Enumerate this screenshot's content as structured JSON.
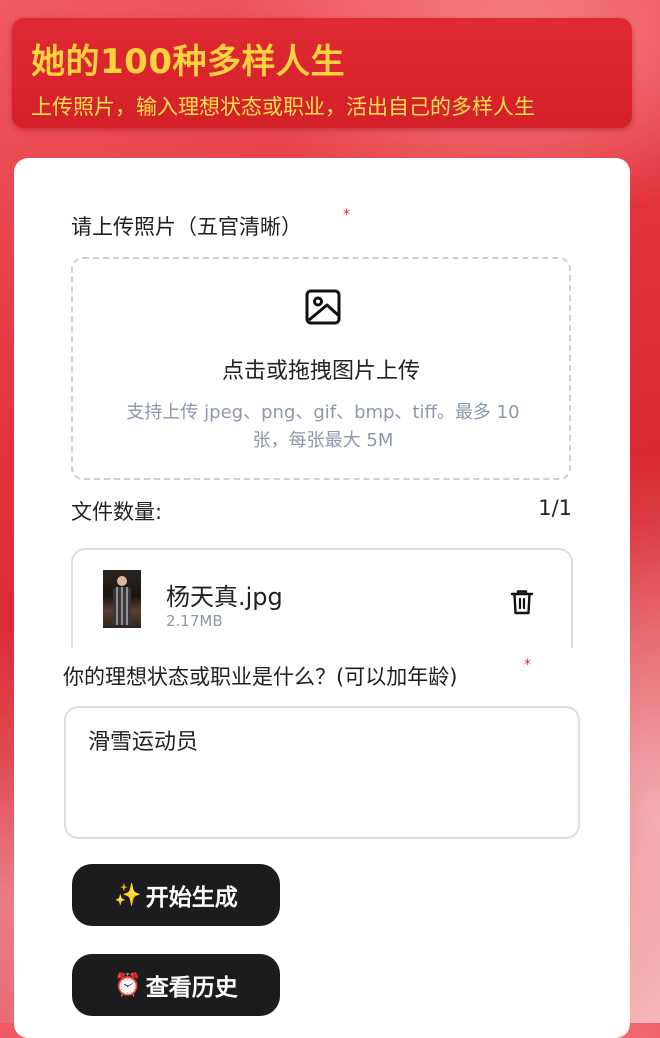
{
  "header": {
    "title": "她的100种多样人生",
    "subtitle": "上传照片，输入理想状态或职业，活出自己的多样人生"
  },
  "upload": {
    "label": "请上传照片（五官清晰）",
    "required_mark": "*",
    "dropzone_title": "点击或拖拽图片上传",
    "dropzone_hint": "支持上传 jpeg、png、gif、bmp、tiff。最多 10 张，每张最大 5M",
    "count_label": "文件数量:",
    "count_value": "1/1",
    "file": {
      "name": "杨天真.jpg",
      "size": "2.17MB"
    }
  },
  "prompt": {
    "label": "你的理想状态或职业是什么？(可以加年龄)",
    "required_mark": "*",
    "value": "滑雪运动员"
  },
  "buttons": {
    "generate_emoji": "✨",
    "generate_label": "开始生成",
    "history_emoji": "⏰",
    "history_label": "查看历史"
  },
  "icons": {
    "dropzone": "image-icon",
    "delete": "trash-icon"
  },
  "colors": {
    "header_bg": "#d42029",
    "header_title": "#ffd23f",
    "button_bg": "#1c1c1f",
    "required": "#e0282f"
  }
}
